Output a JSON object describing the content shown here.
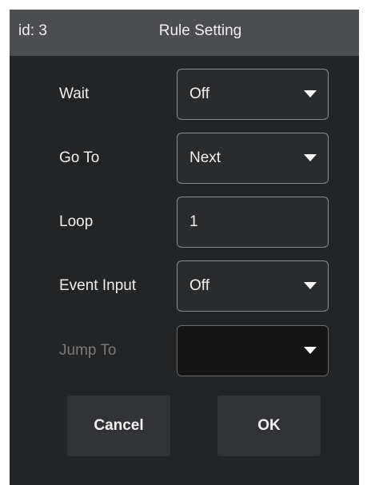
{
  "title_bar": {
    "id_text": "id:  3",
    "title": "Rule Setting"
  },
  "rows": [
    {
      "label": "Wait",
      "value": "Off",
      "kind": "dropdown"
    },
    {
      "label": "Go To",
      "value": "Next",
      "kind": "dropdown"
    },
    {
      "label": "Loop",
      "value": "1",
      "kind": "input"
    },
    {
      "label": "Event Input",
      "value": "Off",
      "kind": "dropdown"
    },
    {
      "label": "Jump To",
      "value": "",
      "kind": "dropdown",
      "disabled": true
    }
  ],
  "buttons": {
    "cancel": "Cancel",
    "ok": "OK"
  },
  "colors": {
    "title_bar": "#4c4d50",
    "dialog_bg": "#232426",
    "field_border": "#8a8b8e",
    "disabled_label": "#7a7a7a",
    "button_bg": "#323336"
  }
}
